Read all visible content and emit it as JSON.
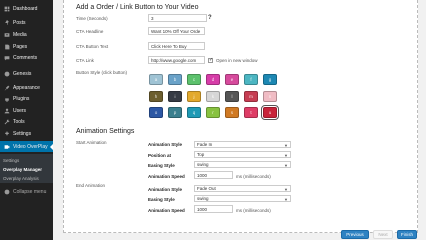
{
  "sidebar": {
    "items": [
      {
        "label": "Dashboard",
        "icon": "dashboard-icon"
      },
      {
        "label": "Posts",
        "icon": "pin-icon"
      },
      {
        "label": "Media",
        "icon": "media-icon"
      },
      {
        "label": "Pages",
        "icon": "pages-icon"
      },
      {
        "label": "Comments",
        "icon": "comments-icon"
      },
      {
        "label": "Genesis",
        "icon": "genesis-icon"
      },
      {
        "label": "Appearance",
        "icon": "brush-icon"
      },
      {
        "label": "Plugins",
        "icon": "plugin-icon"
      },
      {
        "label": "Users",
        "icon": "users-icon"
      },
      {
        "label": "Tools",
        "icon": "wrench-icon"
      },
      {
        "label": "Settings",
        "icon": "settings-icon"
      },
      {
        "label": "Video OverPlay",
        "icon": "video-icon"
      }
    ],
    "submenu": [
      "Settings",
      "Overplay Manager",
      "Overplay Analysis"
    ],
    "collapse_label": "Collapse menu"
  },
  "form": {
    "heading": "Add a Order / Link Button to Your Video",
    "time_label": "Time (Seconds)",
    "time_value": "3",
    "headline_label": "CTA Headline",
    "headline_value": "Want 10% Off Your Orde",
    "button_text_label": "CTA Button Text",
    "button_text_value": "Click Here To Buy",
    "link_label": "CTA Link",
    "link_value": "http://www.google.com",
    "new_window_label": "Open in new window",
    "button_style_label": "Button Style (click button)",
    "swatch_row1": [
      "a",
      "b",
      "c",
      "d",
      "e",
      "f",
      "g"
    ],
    "swatch_row2": [
      "h",
      "i",
      "j",
      "k",
      "l",
      "m",
      "n"
    ],
    "swatch_row3": [
      "o",
      "p",
      "q",
      "r",
      "s",
      "t",
      "u"
    ],
    "help_glyph": "?"
  },
  "animation": {
    "heading": "Animation Settings",
    "start_label": "Start Animation",
    "end_label": "End Animation",
    "style_label": "Animation Style",
    "position_label": "Position at",
    "easing_label": "Easing Style",
    "speed_label": "Animation Speed",
    "speed_unit": "ms (milliseconds)",
    "start": {
      "style": "Fade In",
      "position": "Top",
      "easing": "swing",
      "speed": "1000"
    },
    "end": {
      "style": "Fade Out",
      "easing": "swing",
      "speed": "1000"
    }
  },
  "footer": {
    "previous": "Previous",
    "next": "Next",
    "finish": "Finish"
  },
  "colors": {
    "swatches": [
      "#9fc3d4",
      "#6aa2c8",
      "#5cc16d",
      "#d63da8",
      "#d64a9c",
      "#4cb6c2",
      "#1d88b3",
      "#6c5e2e",
      "#363b44",
      "#e2a92d",
      "#d7d7d7",
      "#555555",
      "#c63d52",
      "#f0bcc4",
      "#2c57a4",
      "#3a7f8e",
      "#1e9ab5",
      "#88c240",
      "#d07a24",
      "#de3d66",
      "#c8243a"
    ]
  }
}
